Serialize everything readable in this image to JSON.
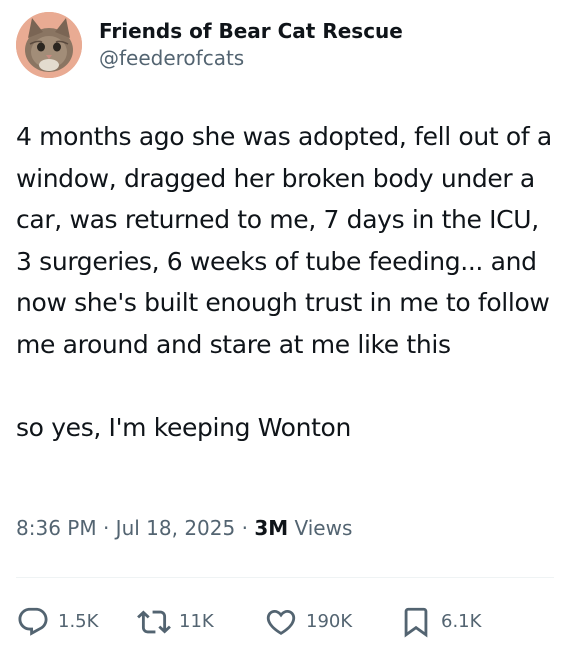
{
  "author": {
    "display_name": "Friends of Bear Cat Rescue",
    "handle": "@feederofcats",
    "avatar_icon": "cat-photo-avatar"
  },
  "tweet": {
    "text": "4 months ago she was adopted, fell out of a window, dragged her broken body under a car, was returned to me, 7 days in the ICU, 3 surgeries, 6 weeks of tube feeding... and now she's built enough trust in me to follow me around and stare at me like this\n\nso yes, I'm keeping Wonton"
  },
  "meta": {
    "time": "8:36 PM",
    "separator": "·",
    "date": "Jul 18, 2025",
    "views_count": "3M",
    "views_label": "Views"
  },
  "actions": {
    "reply": {
      "icon": "reply-icon",
      "count": "1.5K"
    },
    "retweet": {
      "icon": "retweet-icon",
      "count": "11K"
    },
    "like": {
      "icon": "heart-icon",
      "count": "190K"
    },
    "bookmark": {
      "icon": "bookmark-icon",
      "count": "6.1K"
    }
  },
  "colors": {
    "primary_text": "#0f1419",
    "secondary_text": "#536471",
    "divider": "#eff3f4"
  }
}
